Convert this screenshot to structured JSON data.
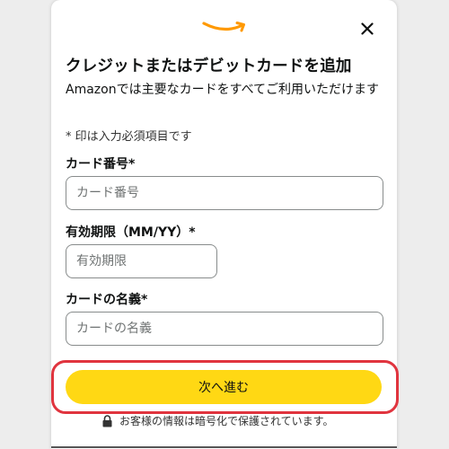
{
  "header": {
    "logo_icon": "amazon-smile-icon",
    "close_icon": "close-icon",
    "brand_color": "#ff9900"
  },
  "form": {
    "title": "クレジットまたはデビットカードを追加",
    "subtitle": "Amazonでは主要なカードをすべてご利用いただけます",
    "required_note": "* 印は入力必須項目です",
    "card_number": {
      "label": "カード番号*",
      "placeholder": "カード番号",
      "value": ""
    },
    "expiry": {
      "label": "有効期限（MM/YY）*",
      "placeholder": "有効期限",
      "value": ""
    },
    "card_name": {
      "label": "カードの名義*",
      "placeholder": "カードの名義",
      "value": ""
    }
  },
  "actions": {
    "next_label": "次へ進む",
    "button_color": "#ffd814",
    "highlight_color": "#e0343e"
  },
  "footer": {
    "lock_icon": "lock-icon",
    "secure_note": "お客様の情報は暗号化で保護されています。"
  }
}
